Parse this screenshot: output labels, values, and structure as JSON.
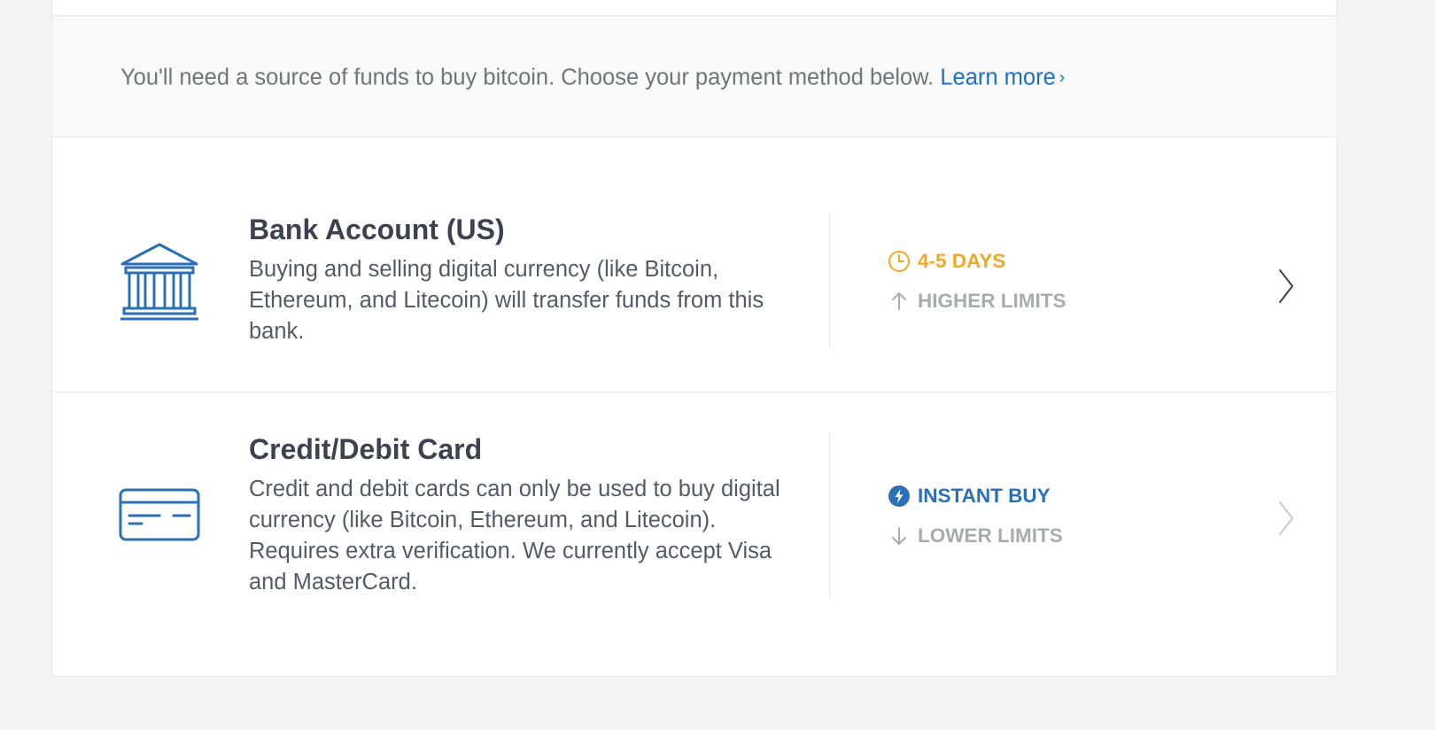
{
  "intro": {
    "text": "You'll need a source of funds to buy bitcoin. Choose your payment method below.",
    "link_label": "Learn more",
    "link_chevron": "›"
  },
  "methods": [
    {
      "icon": "bank-icon",
      "title": "Bank Account (US)",
      "description": "Buying and selling digital currency (like Bitcoin, Ethereum, and Litecoin) will transfer funds from this bank.",
      "features": [
        {
          "icon": "clock-icon",
          "label": "4-5 DAYS",
          "color": "#f5a623"
        },
        {
          "icon": "arrow-up-icon",
          "label": "HIGHER LIMITS",
          "color": "#a8abb0"
        }
      ],
      "enabled": true
    },
    {
      "icon": "credit-card-icon",
      "title": "Credit/Debit Card",
      "description": "Credit and debit cards can only be used to buy digital currency (like Bitcoin, Ethereum, and Litecoin). Requires extra verification. We currently accept Visa and MasterCard.",
      "features": [
        {
          "icon": "lightning-icon",
          "label": "INSTANT BUY",
          "color": "#2b6fb6"
        },
        {
          "icon": "arrow-down-icon",
          "label": "LOWER LIMITS",
          "color": "#a8abb0"
        }
      ],
      "enabled": false
    }
  ],
  "colors": {
    "accent_blue": "#1b6fc4",
    "icon_blue": "#2b6fb6",
    "warning_orange": "#f5a623",
    "muted_gray": "#a8abb0",
    "title_dark": "#3c4250",
    "body_text": "#555b66"
  }
}
